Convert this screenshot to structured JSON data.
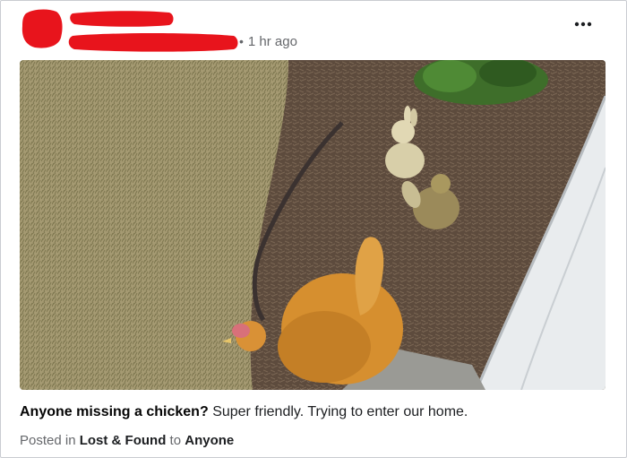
{
  "post": {
    "timestamp_separator": "•",
    "timestamp": "1 hr ago",
    "more_icon": "more-horizontal-icon",
    "caption_lead": "Anyone missing a chicken?",
    "caption_rest": "Super friendly. Trying to enter our home.",
    "posted_in_prefix": "Posted in",
    "group_link": "Lost & Found",
    "audience_prefix": "to",
    "audience_link": "Anyone"
  },
  "colors": {
    "redaction": "#e8141c",
    "meta_text": "#65676b",
    "body_text": "#1c1e21"
  }
}
